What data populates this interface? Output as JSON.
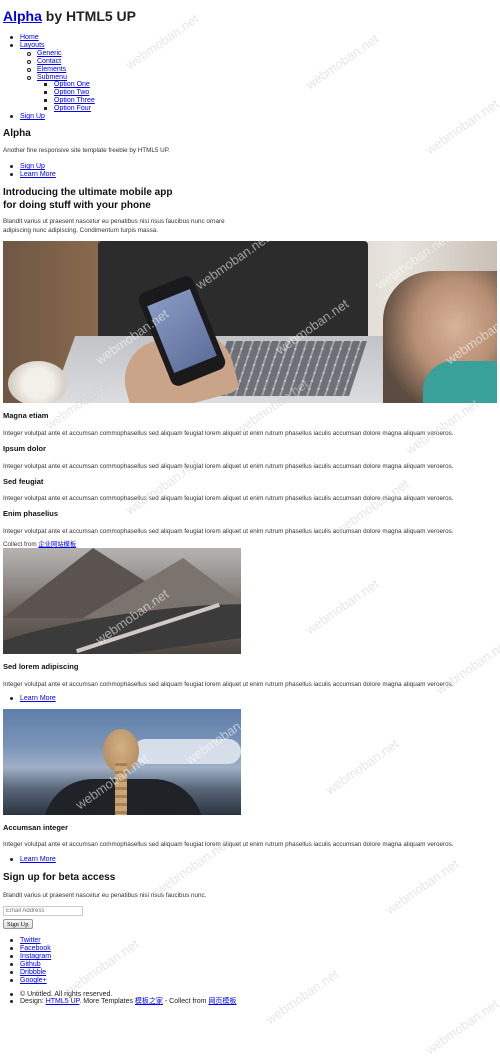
{
  "header": {
    "title_link": "Alpha",
    "title_rest": " by HTML5 UP"
  },
  "nav": {
    "home": "Home",
    "layouts": "Layouts",
    "generic": "Generic",
    "contact": "Contact",
    "elements": "Elements",
    "submenu": "Submenu",
    "options": [
      "Option One",
      "Option Two",
      "Option Three",
      "Option Four"
    ],
    "signup": "Sign Up"
  },
  "banner": {
    "title": "Alpha",
    "tagline": "Another fine responsive site template freebie by HTML5 UP.",
    "actions": [
      "Sign Up",
      "Learn More"
    ]
  },
  "intro": {
    "heading_line1": "Introducing the ultimate mobile app",
    "heading_line2": "for doing stuff with your phone",
    "text_line1": "Blandit varius ut praesent nascetur eu penatibus nisi risus faucibus nunc ornare",
    "text_line2": "adipiscing nunc adipiscing. Condimentum turpis massa."
  },
  "features": [
    {
      "title": "Magna etiam",
      "text": "Integer volutpat ante et accumsan commophasellus sed aliquam feugiat lorem aliquet ut enim rutrum phasellus iaculis accumsan dolore magna aliquam veroeros."
    },
    {
      "title": "Ipsum dolor",
      "text": "Integer volutpat ante et accumsan commophasellus sed aliquam feugiat lorem aliquet ut enim rutrum phasellus iaculis accumsan dolore magna aliquam veroeros."
    },
    {
      "title": "Sed feugiat",
      "text": "Integer volutpat ante et accumsan commophasellus sed aliquam feugiat lorem aliquet ut enim rutrum phasellus iaculis accumsan dolore magna aliquam veroeros."
    },
    {
      "title": "Enim phaselius",
      "text": "Integer volutpat ante et accumsan commophasellus sed aliquam feugiat lorem aliquet ut enim rutrum phasellus iaculis accumsan dolore magna aliquam veroeros."
    }
  ],
  "collect": {
    "prefix": "Collect from ",
    "link": "企业网站模板"
  },
  "card1": {
    "title": "Sed lorem adipiscing",
    "text": "Integer volutpat ante et accumsan commophasellus sed aliquam feugiat lorem aliquet ut enim rutrum phasellus iaculis accumsan dolore magna aliquam veroeros.",
    "link": "Learn More"
  },
  "card2": {
    "title": "Accumsan integer",
    "text": "Integer volutpat ante et accumsan commophasellus sed aliquam feugiat lorem aliquet ut enim rutrum phasellus iaculis accumsan dolore magna aliquam veroeros.",
    "link": "Learn More"
  },
  "cta": {
    "title": "Sign up for beta access",
    "text": "Blandit varius ut praesent nascetur eu penatibus nisi risus faucibus nunc.",
    "email_placeholder": "Email Address",
    "button": "Sign Up"
  },
  "social": [
    "Twitter",
    "Facebook",
    "Instagram",
    "Github",
    "Dribbble",
    "Google+"
  ],
  "footer": {
    "copyright": "© Untitled. All rights reserved.",
    "design_prefix": "Design: ",
    "design_link": "HTML5 UP",
    "more_prefix": ". More Templates ",
    "more_link": "模板之家",
    "collect_prefix": " - Collect from ",
    "collect_link": "网页模板"
  },
  "watermark": "webmoban.net"
}
